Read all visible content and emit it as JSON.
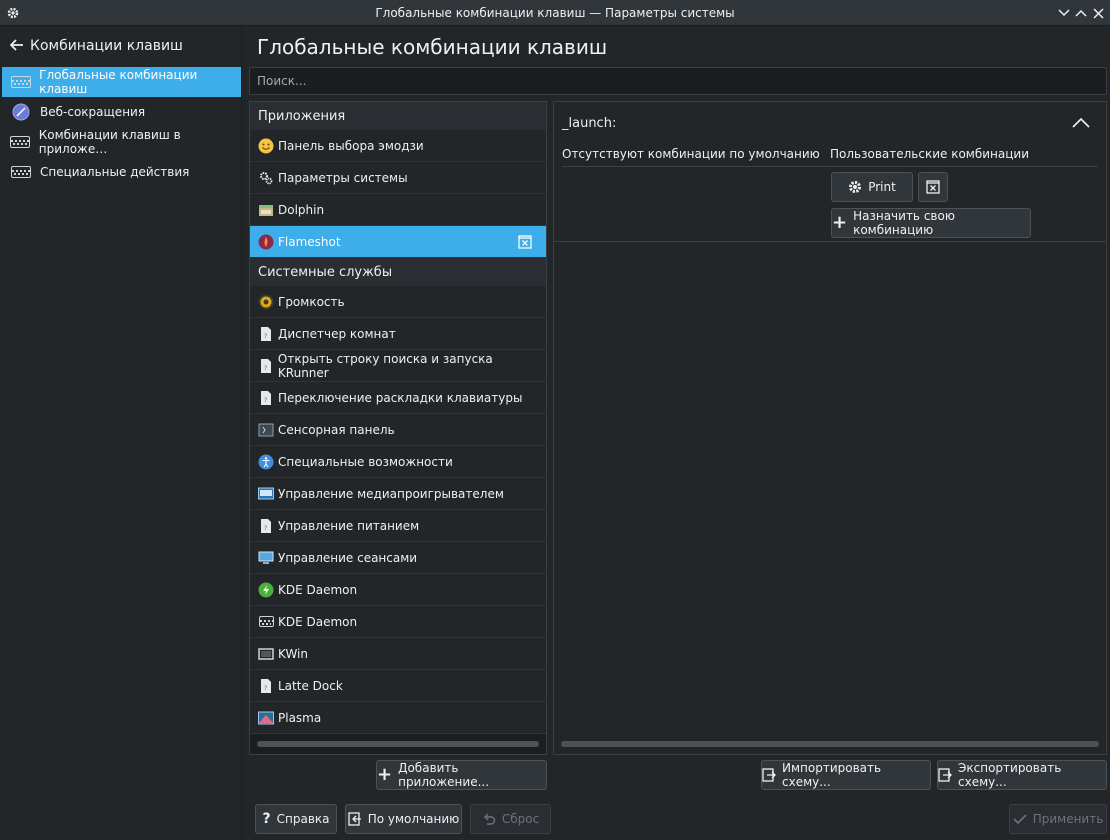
{
  "window": {
    "title": "Глобальные комбинации клавиш — Параметры системы"
  },
  "sidebar": {
    "back_label": "Комбинации клавиш",
    "items": [
      {
        "label": "Глобальные комбинации клавиш",
        "icon": "keyboard-icon",
        "active": true
      },
      {
        "label": "Веб-сокращения",
        "icon": "web-browser-icon",
        "active": false
      },
      {
        "label": "Комбинации клавиш в приложе…",
        "icon": "keyboard-icon",
        "active": false
      },
      {
        "label": "Специальные действия",
        "icon": "keyboard-icon",
        "active": false
      }
    ]
  },
  "main": {
    "title": "Глобальные комбинации клавиш",
    "search_placeholder": "Поиск..."
  },
  "components": {
    "sections": [
      {
        "title": "Приложения",
        "items": [
          {
            "label": "Панель выбора эмодзи",
            "icon": "emoji-icon"
          },
          {
            "label": "Параметры системы",
            "icon": "settings-icon"
          },
          {
            "label": "Dolphin",
            "icon": "dolphin-icon"
          },
          {
            "label": "Flameshot",
            "icon": "flameshot-icon",
            "active": true
          }
        ]
      },
      {
        "title": "Системные службы",
        "items": [
          {
            "label": "Громкость",
            "icon": "volume-icon"
          },
          {
            "label": "Диспетчер комнат",
            "icon": "file-icon"
          },
          {
            "label": "Открыть строку поиска и запуска KRunner",
            "icon": "file-icon"
          },
          {
            "label": "Переключение раскладки клавиатуры",
            "icon": "file-icon"
          },
          {
            "label": "Сенсорная панель",
            "icon": "touchpad-icon"
          },
          {
            "label": "Специальные возможности",
            "icon": "accessibility-icon"
          },
          {
            "label": "Управление медиапроигрывателем",
            "icon": "media-player-icon"
          },
          {
            "label": "Управление питанием",
            "icon": "file-icon"
          },
          {
            "label": "Управление сеансами",
            "icon": "session-icon"
          },
          {
            "label": "KDE Daemon",
            "icon": "kded-icon"
          },
          {
            "label": "KDE Daemon",
            "icon": "keyboard-icon"
          },
          {
            "label": "KWin",
            "icon": "kwin-icon"
          },
          {
            "label": "Latte Dock",
            "icon": "file-icon"
          },
          {
            "label": "Plasma",
            "icon": "plasma-icon"
          }
        ]
      }
    ]
  },
  "details": {
    "action_name": "_launch:",
    "default_header": "Отсутствуют комбинации по умолчанию",
    "custom_header": "Пользовательские комбинации",
    "shortcut_label": "Print",
    "add_custom_label": "Назначить свою комбинацию"
  },
  "buttons": {
    "add_app": "Добавить приложение...",
    "import_scheme": "Импортировать схему...",
    "export_scheme": "Экспортировать схему...",
    "help": "Справка",
    "defaults": "По умолчанию",
    "reset": "Сброс",
    "apply": "Применить"
  },
  "colors": {
    "accent": "#3daee9",
    "background": "#232629",
    "surface": "#31363b"
  }
}
